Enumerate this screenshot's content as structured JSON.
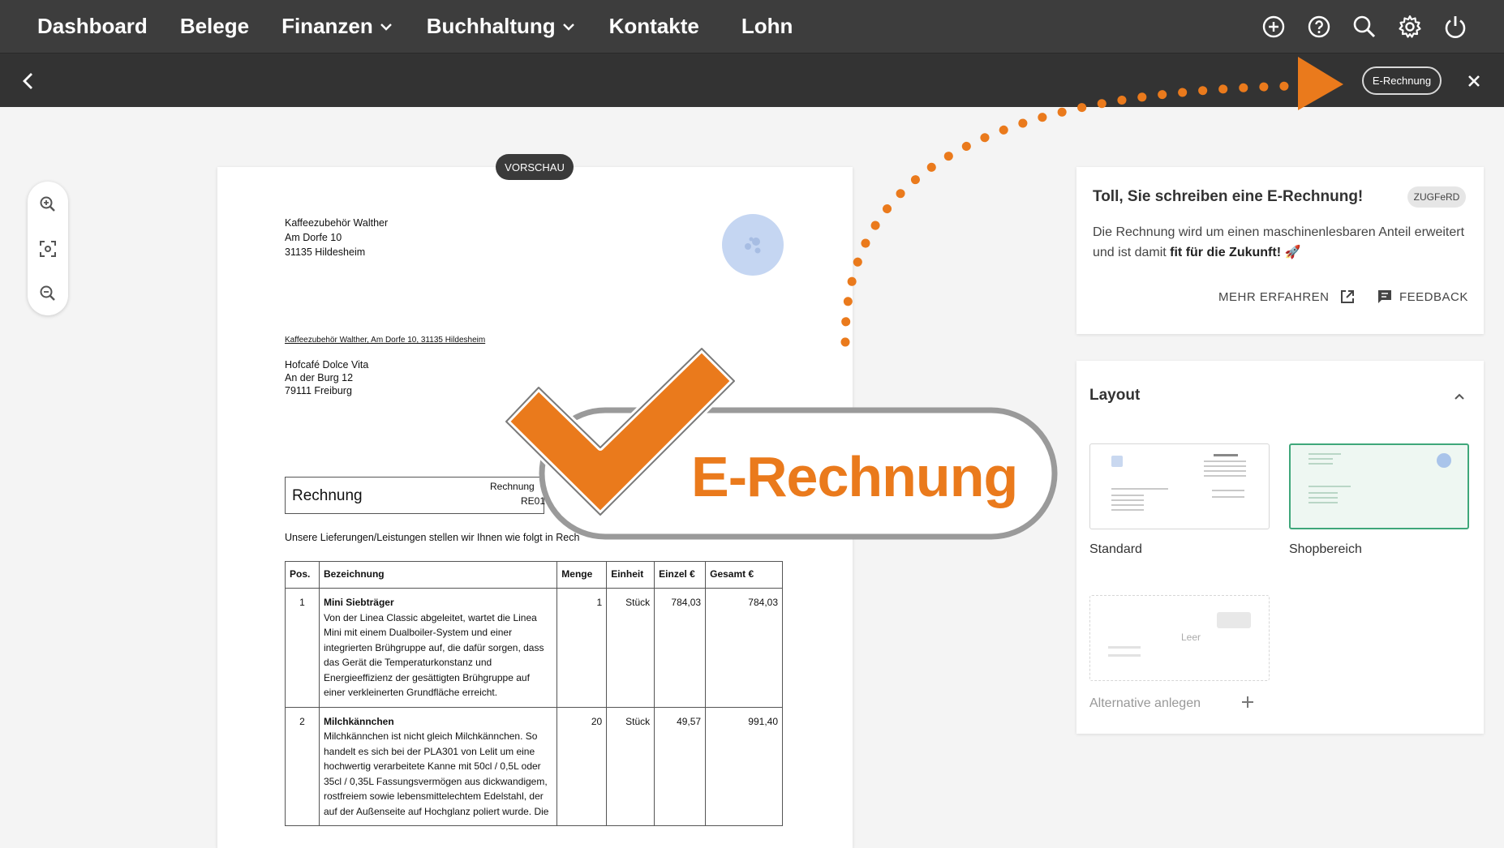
{
  "nav": {
    "items": [
      {
        "label": "Dashboard"
      },
      {
        "label": "Belege"
      },
      {
        "label": "Finanzen"
      },
      {
        "label": "Buchhaltung"
      },
      {
        "label": "Kontakte"
      },
      {
        "label": "Lohn"
      }
    ],
    "icons": [
      "add-circle-icon",
      "help-icon",
      "search-icon",
      "settings-gear-icon",
      "power-icon"
    ]
  },
  "subbar": {
    "erechnung_label": "E-Rechnung"
  },
  "document": {
    "badge": "VORSCHAU",
    "sender": [
      "Kaffeezubehör Walther",
      "Am Dorfe 10",
      "31135 Hildesheim"
    ],
    "return_line": "Kaffeezubehör Walther, Am Dorfe 10, 31135 Hildesheim",
    "recipient": [
      "Hofcafé Dolce Vita",
      "An der Burg 12",
      "79111 Freiburg"
    ],
    "invoice_title": "Rechnung",
    "invoice_meta_1": "Rechnung",
    "invoice_meta_2": "RE01",
    "intro": "Unsere Lieferungen/Leistungen stellen wir Ihnen wie folgt in Rech",
    "table": {
      "headers": [
        "Pos.",
        "Bezeichnung",
        "Menge",
        "Einheit",
        "Einzel €",
        "Gesamt €"
      ],
      "rows": [
        {
          "pos": "1",
          "name": "Mini Siebträger",
          "desc": "Von der Linea Classic abgeleitet, wartet die Linea Mini mit einem Dualboiler-System und einer integrierten Brühgruppe auf, die dafür sorgen, dass das Gerät die Temperaturkonstanz und Energieeffizienz der gesättigten Brühgruppe auf einer verkleinerten Grundfläche erreicht.",
          "menge": "1",
          "einheit": "Stück",
          "einzel": "784,03",
          "gesamt": "784,03"
        },
        {
          "pos": "2",
          "name": "Milchkännchen",
          "desc": "Milchkännchen ist nicht gleich Milchkännchen. So handelt es sich bei der PLA301 von Lelit um eine hochwertig verarbeitete Kanne mit 50cl / 0,5L oder 35cl / 0,35L Fassungsvermögen aus dickwandigem, rostfreiem sowie lebensmittelechtem Edelstahl, der auf der Außenseite auf Hochglanz poliert wurde. Die",
          "menge": "20",
          "einheit": "Stück",
          "einzel": "49,57",
          "gesamt": "991,40"
        }
      ]
    }
  },
  "overlay": {
    "badge_text": "E-Rechnung",
    "accent_color": "#ea7a1c"
  },
  "info_card": {
    "title": "Toll, Sie schreiben eine E-Rechnung!",
    "tag": "ZUGFeRD",
    "text_before": "Die Rechnung wird um einen maschinenlesbaren Anteil erweitert und ist damit ",
    "text_bold": "fit für die Zukunft!",
    "text_emoji": " 🚀",
    "more_label": "MEHR ERFAHREN",
    "feedback_label": "FEEDBACK"
  },
  "layout_panel": {
    "title": "Layout",
    "options": [
      {
        "label": "Standard",
        "selected": false
      },
      {
        "label": "Shopbereich",
        "selected": true
      }
    ],
    "empty_label": "Leer",
    "alternative_label": "Alternative anlegen",
    "selected_color": "#3fa77a"
  }
}
